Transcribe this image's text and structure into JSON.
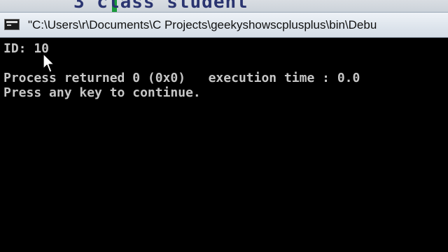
{
  "window": {
    "title": "\"C:\\Users\\r\\Documents\\C Projects\\geekyshowscplusplus\\bin\\Debu"
  },
  "background": {
    "code_fragment": "3   class student"
  },
  "console": {
    "lines": [
      "ID: 10",
      "Process returned 0 (0x0)   execution time : 0.0",
      "Press any key to continue."
    ]
  },
  "icons": {
    "app": "console-app-icon",
    "pointer": "mouse-pointer-icon"
  },
  "colors": {
    "console_background": "#000000",
    "console_text": "#c6c6c6",
    "titlebar": "#dde4ec",
    "code_keyword": "#2a3470"
  }
}
